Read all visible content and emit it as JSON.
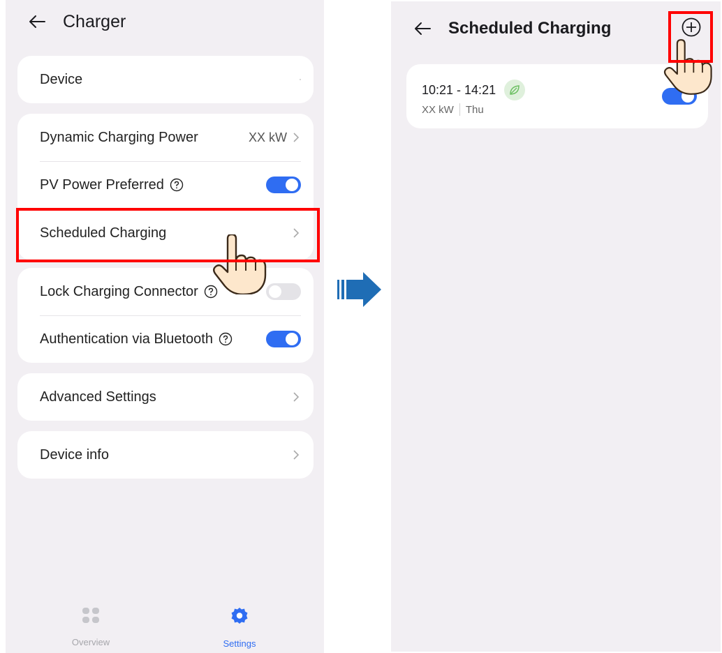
{
  "left_screen": {
    "header": {
      "title": "Charger"
    },
    "device_card": {
      "label": "Device"
    },
    "settings_card": {
      "dynamic_power": {
        "label": "Dynamic Charging Power",
        "value": "XX  kW"
      },
      "pv_preferred": {
        "label": "PV Power Preferred",
        "toggle": "on"
      },
      "scheduled_charging": {
        "label": "Scheduled Charging"
      }
    },
    "lock_card": {
      "lock_connector": {
        "label": "Lock Charging Connector",
        "toggle": "off"
      },
      "auth_bluetooth": {
        "label": "Authentication via Bluetooth",
        "toggle": "on"
      }
    },
    "advanced_card": {
      "label": "Advanced Settings"
    },
    "device_info_card": {
      "label": "Device info"
    },
    "tabbar": {
      "overview_label": "Overview",
      "settings_label": "Settings",
      "active_color": "#2f6df2",
      "inactive_color": "#a6a6ab"
    }
  },
  "right_screen": {
    "header": {
      "title": "Scheduled Charging"
    },
    "schedule_item": {
      "time_range": "10:21 - 14:21",
      "power": "XX kW",
      "days": "Thu",
      "toggle": "on"
    }
  },
  "colors": {
    "accent": "#2f6df2",
    "highlight": "#ff0000",
    "arrow": "#1f6db5",
    "leaf": "#6cbf62"
  }
}
